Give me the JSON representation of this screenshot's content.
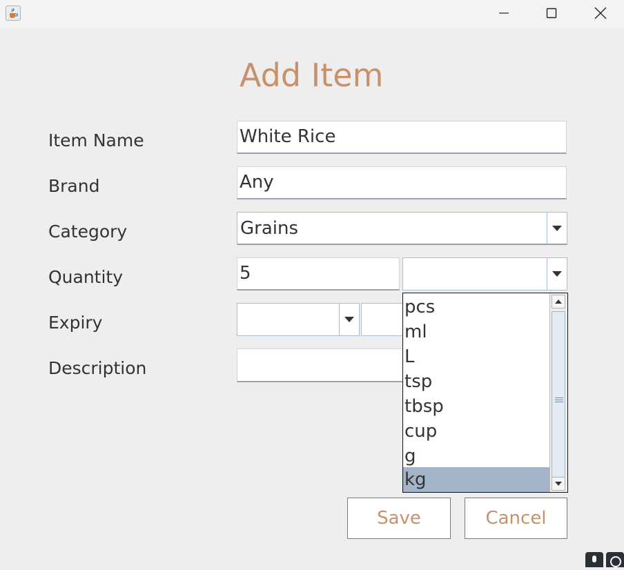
{
  "window": {
    "minimize_icon": "minimize-icon",
    "maximize_icon": "maximize-icon",
    "close_icon": "close-icon",
    "app_icon": "java-cup-icon"
  },
  "form": {
    "title": "Add Item",
    "item_name": {
      "label": "Item Name",
      "value": "White Rice"
    },
    "brand": {
      "label": "Brand",
      "value": "Any"
    },
    "category": {
      "label": "Category",
      "value": "Grains"
    },
    "quantity": {
      "label": "Quantity",
      "value": "5",
      "unit_value": ""
    },
    "expiry": {
      "label": "Expiry",
      "part1_value": "",
      "part2_value": ""
    },
    "description": {
      "label": "Description",
      "value": ""
    }
  },
  "unit_dropdown": {
    "options": [
      "pcs",
      "ml",
      "L",
      "tsp",
      "tbsp",
      "cup",
      "g",
      "kg"
    ],
    "highlighted": "kg"
  },
  "buttons": {
    "save": "Save",
    "cancel": "Cancel"
  },
  "colors": {
    "accent": "#c7916c",
    "selection": "#a3b3c8",
    "background": "#eeeeee"
  }
}
